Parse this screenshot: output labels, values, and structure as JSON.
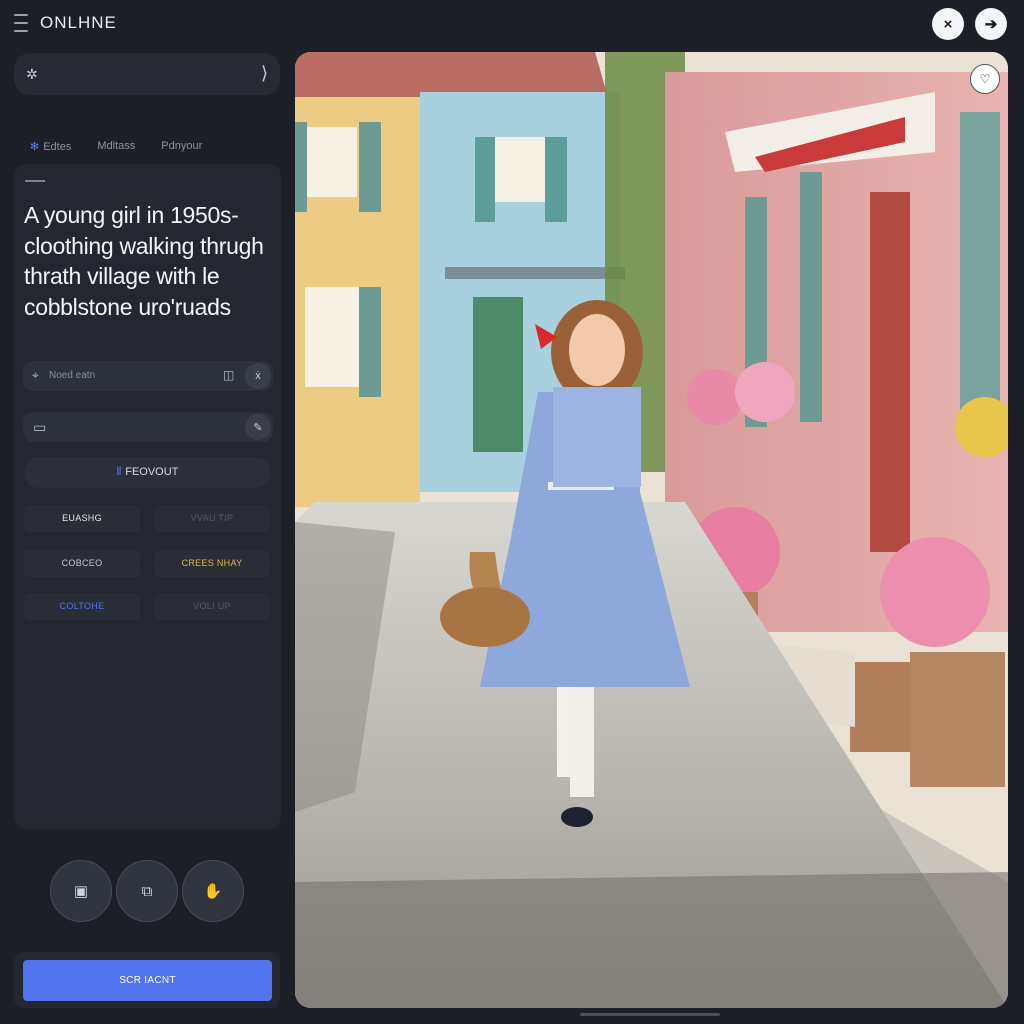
{
  "app": {
    "brand": "ONLHNE"
  },
  "window_controls": {
    "close_glyph": "×",
    "next_glyph": "➔"
  },
  "prompt_bar": {
    "left_icon": "sparkle-icon",
    "right_icon": "chevron-right-icon"
  },
  "tabs": [
    {
      "label": "Edtes",
      "active": true
    },
    {
      "label": "Mdltass",
      "active": false
    },
    {
      "label": "Pdnyour",
      "active": false
    }
  ],
  "prompt_card": {
    "text": "A young girl in 1950s-cloothing walking thrugh thrath village with le cobblstone uro'ruads"
  },
  "negative_field": {
    "placeholder": "Noed eatn"
  },
  "fields": {
    "second_icon": "frame-icon",
    "second_right_icon": "palette-icon"
  },
  "layout_button": {
    "label": "FEOVOUT"
  },
  "options": [
    {
      "label": "EUASHG",
      "color": "#e2e5ec"
    },
    {
      "label": "VVAU TIP",
      "color": "#555a66"
    },
    {
      "label": "COBCEO",
      "color": "#c5c9d2"
    },
    {
      "label": "CREES NHAY",
      "color": "#e0b94a"
    },
    {
      "label": "COLTOHE",
      "color": "#4f74ee"
    },
    {
      "label": "VOLI UP",
      "color": "#555a66"
    }
  ],
  "tools": [
    {
      "name": "image-tool-icon"
    },
    {
      "name": "layers-tool-icon"
    },
    {
      "name": "hand-tool-icon"
    }
  ],
  "generate": {
    "label": "SCR IACNT"
  },
  "image": {
    "alt": "generated image preview",
    "favorite_icon": "heart-icon"
  },
  "colors": {
    "accent": "#4f74ee",
    "background": "#1c1f26",
    "panel": "#242730"
  }
}
